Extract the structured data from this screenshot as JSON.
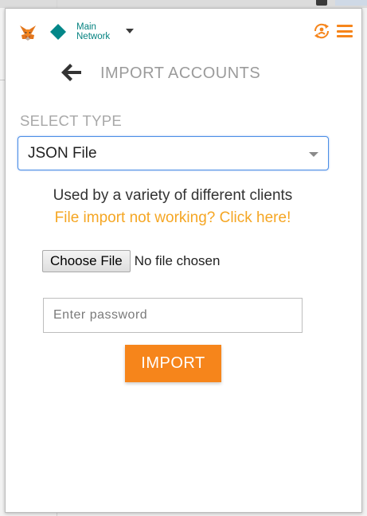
{
  "header": {
    "network_line1": "Main",
    "network_line2": "Network"
  },
  "page": {
    "title": "IMPORT ACCOUNTS"
  },
  "select": {
    "label": "SELECT TYPE",
    "value": "JSON File"
  },
  "description": "Used by a variety of different clients",
  "help_link": "File import not working? Click here!",
  "file_input": {
    "button_label": "Choose File",
    "status": "No file chosen"
  },
  "password": {
    "placeholder": "Enter password"
  },
  "import_button": "IMPORT",
  "colors": {
    "accent": "#f6851b",
    "link": "#f5a623",
    "network": "#058280",
    "focus": "#4c8ee6"
  },
  "icons": {
    "logo": "metamask-fox-icon",
    "network": "network-diamond-icon",
    "account": "account-sync-icon",
    "menu": "hamburger-menu-icon",
    "back": "back-arrow-icon",
    "select_caret": "chevron-down-icon"
  }
}
